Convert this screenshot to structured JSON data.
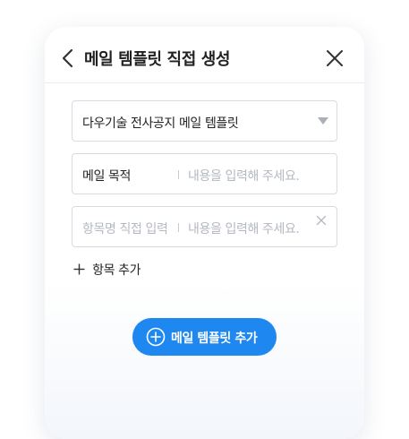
{
  "header": {
    "title": "메일 템플릿 직접 생성",
    "back_icon": "chevron-left-icon",
    "close_icon": "close-icon"
  },
  "template_select": {
    "value": "다우기술 전사공지 메일 템플릿",
    "icon": "caret-down-icon"
  },
  "fields": [
    {
      "label": "메일 목적",
      "value_placeholder": "내용을 입력해 주세요."
    },
    {
      "label_placeholder": "항목명 직접 입력",
      "value_placeholder": "내용을 입력해 주세요.",
      "icon": "clear-icon"
    }
  ],
  "add_item": {
    "label": "항목 추가",
    "icon": "plus-icon"
  },
  "primary_button": {
    "label": "메일 템플릿 추가",
    "icon": "circle-plus-icon",
    "color": "#1e87f0"
  }
}
